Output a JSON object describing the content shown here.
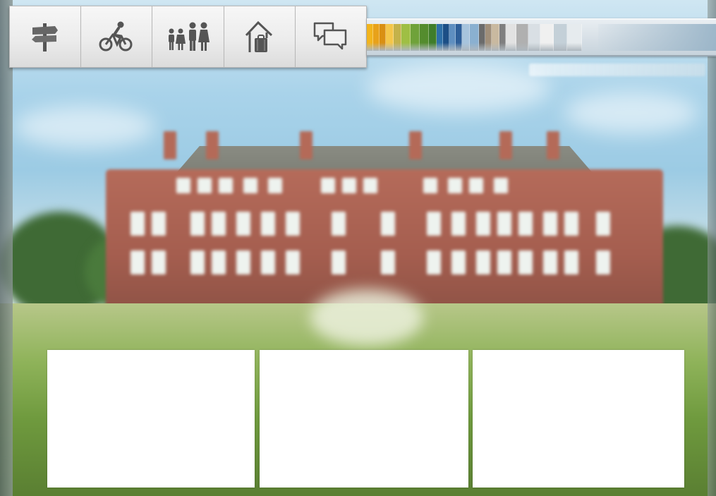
{
  "toolbar": {
    "items": [
      {
        "id": "signpost",
        "icon": "signpost-icon",
        "label": ""
      },
      {
        "id": "cycling",
        "icon": "cyclist-icon",
        "label": ""
      },
      {
        "id": "family",
        "icon": "family-icon",
        "label": ""
      },
      {
        "id": "accommodation",
        "icon": "house-luggage-icon",
        "label": ""
      },
      {
        "id": "chat",
        "icon": "speech-bubbles-icon",
        "label": ""
      }
    ]
  },
  "timeline": {
    "colors": [
      "#f2b41c",
      "#e8a21a",
      "#d98f12",
      "#f4c64a",
      "#c4b24a",
      "#9fbf44",
      "#6fa23a",
      "#548c2e",
      "#3f7d2a",
      "#2d6fa8",
      "#1c4f86",
      "#5f8fc0",
      "#2e5f99",
      "#a7c4dd",
      "#8ab0d0",
      "#6b6b6b",
      "#a08f7a",
      "#c9b9a0",
      "#7f7f7f",
      "#e2e2e2",
      "#b0b0b0",
      "#d9dfe4",
      "#f0f0f0",
      "#c4d0d8",
      "#e6ebee"
    ]
  },
  "panels": [
    {
      "id": "panel-1",
      "content": ""
    },
    {
      "id": "panel-2",
      "content": ""
    },
    {
      "id": "panel-3",
      "content": ""
    }
  ]
}
